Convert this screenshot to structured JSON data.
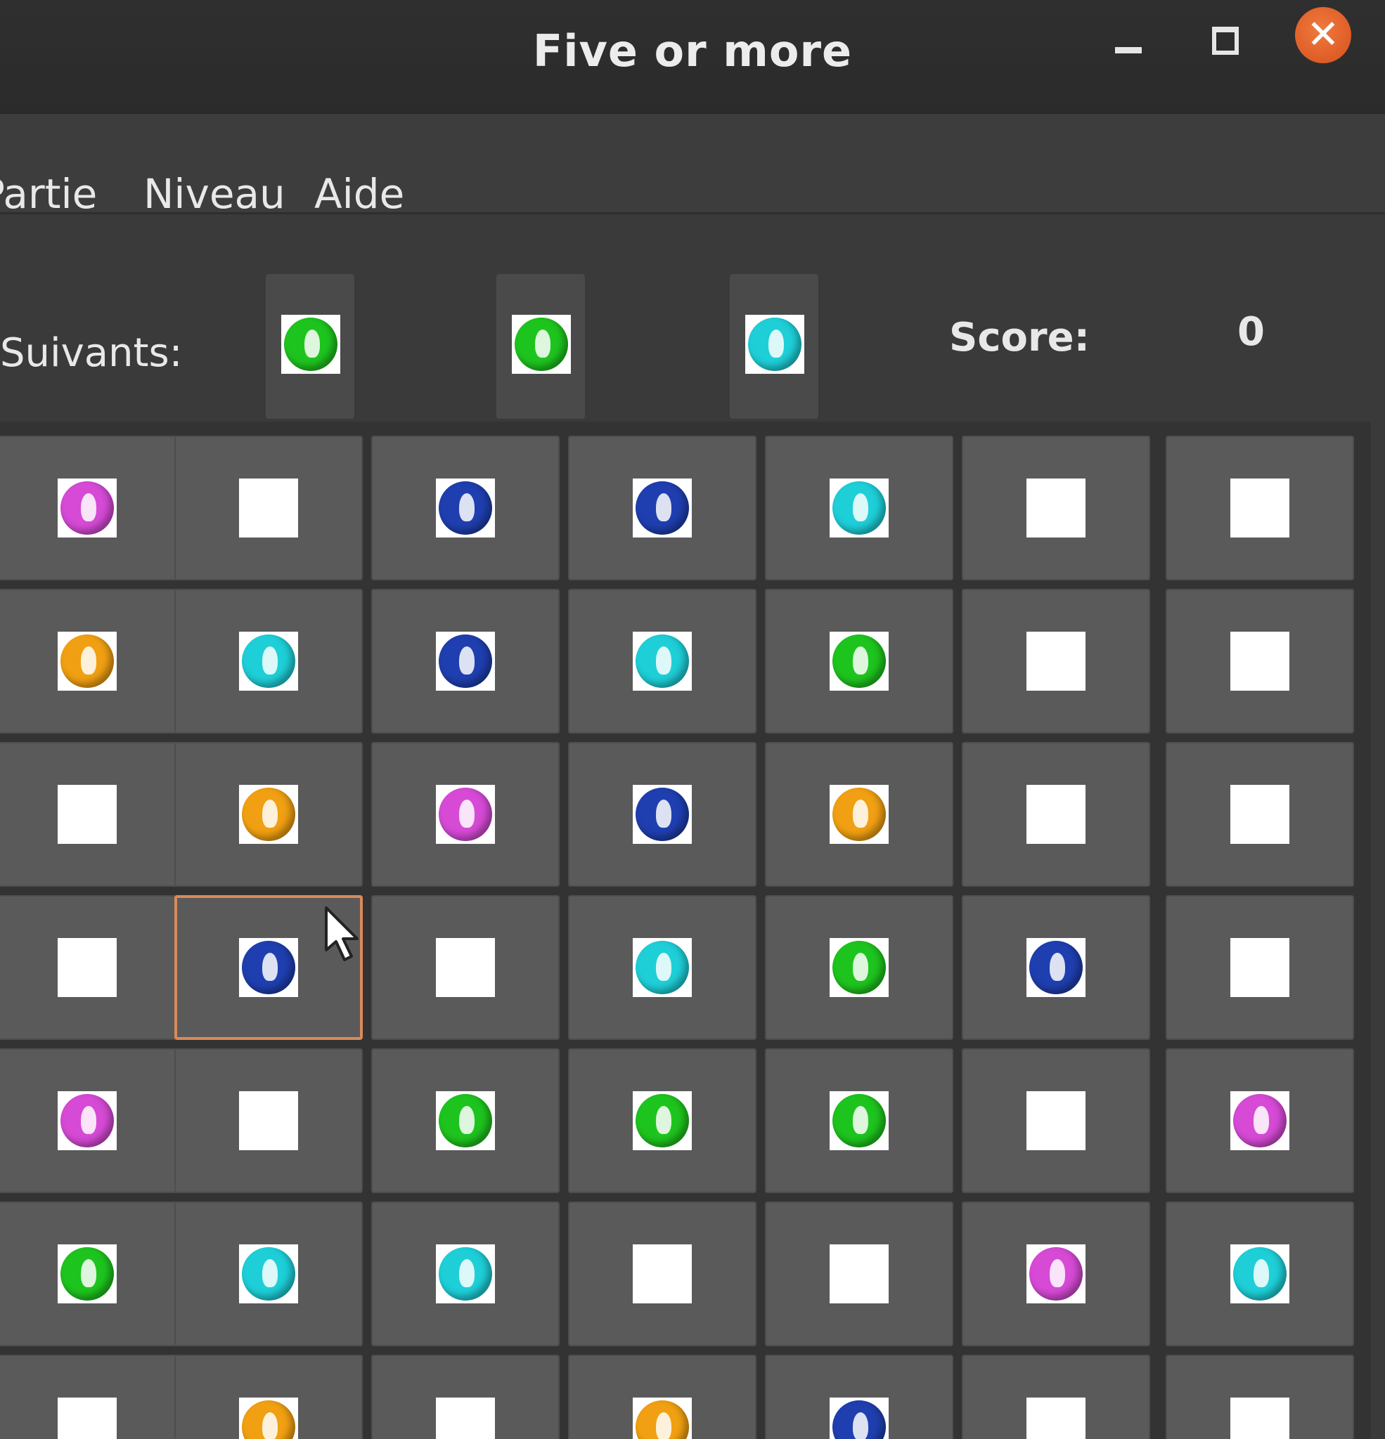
{
  "window": {
    "title": "Five or more"
  },
  "menu": {
    "items": [
      "Partie",
      "Niveau",
      "Aide"
    ]
  },
  "next": {
    "label": "Suivants:",
    "balls": [
      "green",
      "green",
      "cyan"
    ]
  },
  "score": {
    "label": "Score:",
    "value": "0"
  },
  "colors": {
    "magenta": "#d64ad6",
    "blue": "#1f3fb0",
    "cyan": "#1ecfd8",
    "green": "#1ec41e",
    "orange": "#f0a012",
    "empty": "#ffffff",
    "close_button": "#e2622a"
  },
  "board": {
    "selected": [
      3,
      1
    ],
    "rows": [
      [
        "magenta",
        "empty",
        "blue",
        "blue",
        "cyan",
        "empty",
        "empty"
      ],
      [
        "orange",
        "cyan",
        "blue",
        "cyan",
        "green",
        "empty",
        "empty"
      ],
      [
        "empty",
        "orange",
        "magenta",
        "blue",
        "orange",
        "empty",
        "empty"
      ],
      [
        "empty",
        "blue",
        "empty",
        "cyan",
        "green",
        "blue",
        "empty"
      ],
      [
        "magenta",
        "empty",
        "green",
        "green",
        "green",
        "empty",
        "magenta"
      ],
      [
        "green",
        "cyan",
        "cyan",
        "empty",
        "empty",
        "magenta",
        "cyan"
      ],
      [
        "empty",
        "orange",
        "empty",
        "orange",
        "blue",
        "empty",
        "empty"
      ]
    ]
  }
}
